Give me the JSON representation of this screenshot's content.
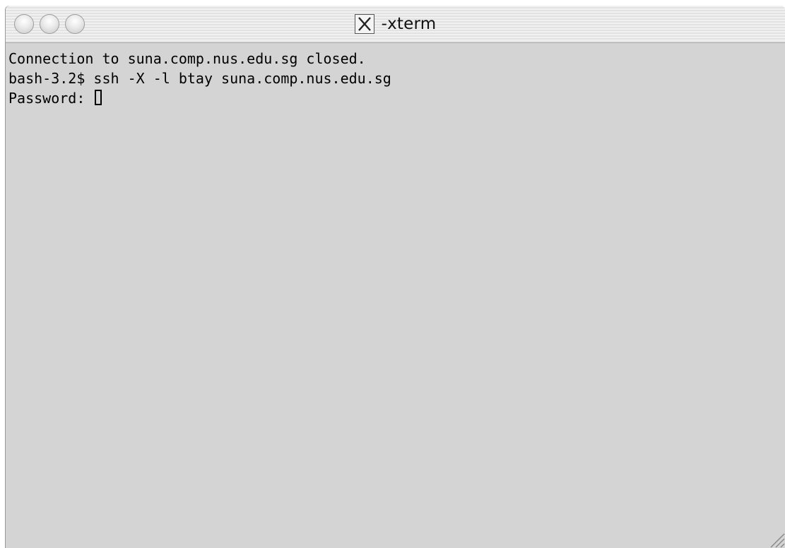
{
  "window": {
    "title": "-xterm",
    "title_icon": "x11-icon",
    "controls": [
      "close-button",
      "minimize-button",
      "zoom-button"
    ]
  },
  "terminal": {
    "lines": [
      "Connection to suna.comp.nus.edu.sg closed.",
      "bash-3.2$ ssh -X -l btay suna.comp.nus.edu.sg",
      "Password: "
    ]
  },
  "colors": {
    "background": "#d4d4d4",
    "text": "#000000"
  }
}
